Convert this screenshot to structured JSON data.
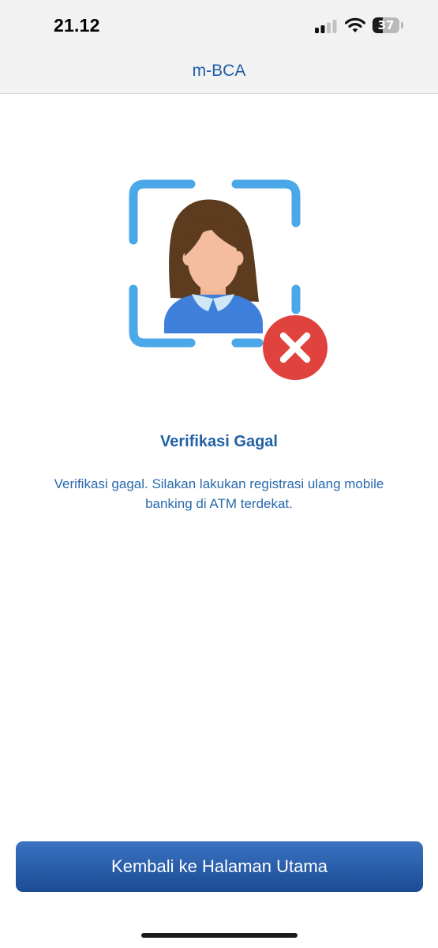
{
  "status_bar": {
    "time": "21.12",
    "battery_level": "37",
    "battery_fraction": 0.37,
    "icons": [
      "signal-icon",
      "wifi-icon",
      "battery-icon"
    ]
  },
  "header": {
    "title": "m-BCA"
  },
  "result": {
    "illustration": "face-verification-failed-illustration",
    "title": "Verifikasi Gagal",
    "message": "Verifikasi gagal. Silakan lakukan registrasi ulang mobile banking di ATM terdekat."
  },
  "actions": {
    "back_home_label": "Kembali ke Halaman Utama"
  },
  "colors": {
    "title_blue": "#2160a5",
    "frame_blue": "#4aa8e8",
    "button_blue": "#2a5ea9",
    "error_red": "#e0423e"
  }
}
